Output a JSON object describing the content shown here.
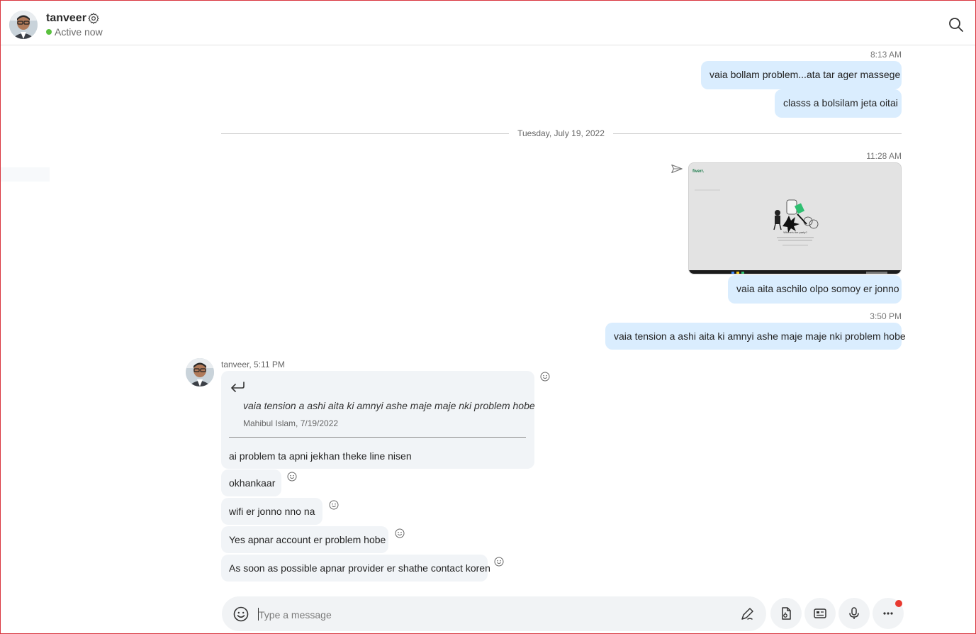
{
  "header": {
    "name": "tanveer",
    "status": "Active now",
    "status_color": "#5ac13e"
  },
  "icons": {
    "settings": "gear-icon",
    "search": "search-icon",
    "send": "send-arrow-icon",
    "reply": "reply-arrow-icon",
    "reaction": "smiley-reaction-icon",
    "emoji": "emoji-icon",
    "format": "pen-icon",
    "file": "file-icon",
    "contact": "contact-card-icon",
    "mic": "microphone-icon",
    "more": "more-icon"
  },
  "colors": {
    "outgoing_bubble": "#daedfe",
    "incoming_bubble": "#f1f4f7",
    "notification": "#e8392f"
  },
  "messages": {
    "time1": "8:13 AM",
    "out1": "vaia bollam problem...ata tar ager massege",
    "out2": "classs a bolsilam jeta oitai",
    "date_divider": "Tuesday, July 19, 2022",
    "time2": "11:28 AM",
    "image_logo": "fiverr.",
    "image_caption": "Where's the party?",
    "out3": "vaia aita aschilo olpo somoy er jonno",
    "time3": "3:50 PM",
    "out4": "vaia tension a ashi aita ki amnyi ashe maje maje nki problem hobe",
    "incoming_sender": "tanveer, 5:11 PM",
    "quote_text": "vaia tension a ashi aita ki amnyi ashe maje maje nki problem hobe",
    "quote_meta": "Mahibul Islam, 7/19/2022",
    "in1": "ai problem ta apni jekhan theke line nisen",
    "in2": "okhankaar",
    "in3": "wifi er jonno nno na",
    "in4": "Yes apnar account er problem hobe",
    "in5": "As soon as possible apnar provider er shathe contact koren"
  },
  "composer": {
    "placeholder": "Type a message"
  }
}
